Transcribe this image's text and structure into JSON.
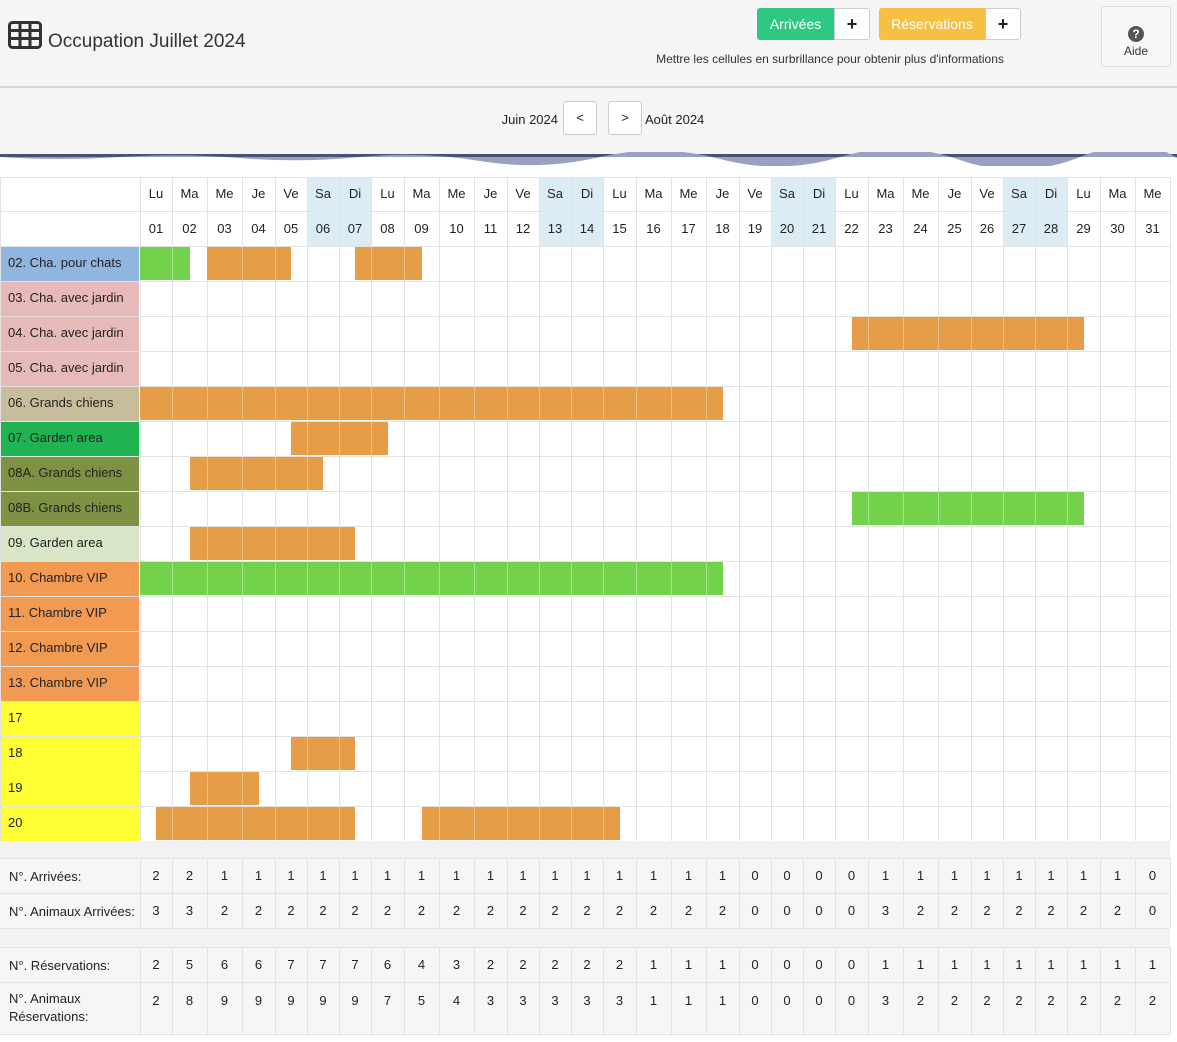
{
  "header": {
    "title": "Occupation Juillet 2024",
    "arrivals_button": "Arrivées",
    "reservations_button": "Réservations",
    "plus_label": "+",
    "hint": "Mettre les cellules en surbrillance pour obtenir plus d'informations",
    "help_label": "Aide",
    "help_icon": "question-circle-icon",
    "app_icon": "table-grid-icon"
  },
  "nav": {
    "prev_month": "Juin 2024",
    "next_month": "Août 2024",
    "prev_symbol": "<",
    "next_symbol": ">"
  },
  "colors": {
    "arrival_bar": "#74d14c",
    "reservation_bar": "#e69d47",
    "weekend_header": "#dcecf5",
    "arrivals_button": "#2ec883",
    "reservations_button": "#f6c143"
  },
  "days": [
    {
      "name": "Lu",
      "num": "01",
      "weekend": false
    },
    {
      "name": "Ma",
      "num": "02",
      "weekend": false
    },
    {
      "name": "Me",
      "num": "03",
      "weekend": false
    },
    {
      "name": "Je",
      "num": "04",
      "weekend": false
    },
    {
      "name": "Ve",
      "num": "05",
      "weekend": false
    },
    {
      "name": "Sa",
      "num": "06",
      "weekend": true
    },
    {
      "name": "Di",
      "num": "07",
      "weekend": true
    },
    {
      "name": "Lu",
      "num": "08",
      "weekend": false
    },
    {
      "name": "Ma",
      "num": "09",
      "weekend": false
    },
    {
      "name": "Me",
      "num": "10",
      "weekend": false
    },
    {
      "name": "Je",
      "num": "11",
      "weekend": false
    },
    {
      "name": "Ve",
      "num": "12",
      "weekend": false
    },
    {
      "name": "Sa",
      "num": "13",
      "weekend": true
    },
    {
      "name": "Di",
      "num": "14",
      "weekend": true
    },
    {
      "name": "Lu",
      "num": "15",
      "weekend": false
    },
    {
      "name": "Ma",
      "num": "16",
      "weekend": false
    },
    {
      "name": "Me",
      "num": "17",
      "weekend": false
    },
    {
      "name": "Je",
      "num": "18",
      "weekend": false
    },
    {
      "name": "Ve",
      "num": "19",
      "weekend": false
    },
    {
      "name": "Sa",
      "num": "20",
      "weekend": true
    },
    {
      "name": "Di",
      "num": "21",
      "weekend": true
    },
    {
      "name": "Lu",
      "num": "22",
      "weekend": false
    },
    {
      "name": "Ma",
      "num": "23",
      "weekend": false
    },
    {
      "name": "Me",
      "num": "24",
      "weekend": false
    },
    {
      "name": "Je",
      "num": "25",
      "weekend": false
    },
    {
      "name": "Ve",
      "num": "26",
      "weekend": false
    },
    {
      "name": "Sa",
      "num": "27",
      "weekend": true
    },
    {
      "name": "Di",
      "num": "28",
      "weekend": true
    },
    {
      "name": "Lu",
      "num": "29",
      "weekend": false
    },
    {
      "name": "Ma",
      "num": "30",
      "weekend": false
    },
    {
      "name": "Me",
      "num": "31",
      "weekend": false
    }
  ],
  "rooms": [
    {
      "label": "02. Cha. pour chats",
      "color": "#8fb5e0",
      "bookings": [
        {
          "start": 1,
          "end": 2.5,
          "kind": "arrival"
        },
        {
          "start": 3,
          "end": 5.5,
          "kind": "reservation"
        },
        {
          "start": 7.5,
          "end": 9.5,
          "kind": "reservation"
        }
      ]
    },
    {
      "label": "03. Cha. avec jardin",
      "color": "#e8b9b9",
      "bookings": []
    },
    {
      "label": "04. Cha. avec jardin",
      "color": "#e8b9b9",
      "bookings": [
        {
          "start": 22.5,
          "end": 29.5,
          "kind": "reservation"
        }
      ]
    },
    {
      "label": "05. Cha. avec jardin",
      "color": "#e8b9b9",
      "bookings": []
    },
    {
      "label": "06. Grands chiens",
      "color": "#c8bd9b",
      "bookings": [
        {
          "start": 1,
          "end": 18.5,
          "kind": "reservation"
        }
      ]
    },
    {
      "label": "07. Garden area",
      "color": "#1fb352",
      "bookings": [
        {
          "start": 5.5,
          "end": 8.5,
          "kind": "reservation"
        }
      ]
    },
    {
      "label": "08A. Grands chiens",
      "color": "#7d9243",
      "bookings": [
        {
          "start": 2.5,
          "end": 6.5,
          "kind": "reservation"
        }
      ]
    },
    {
      "label": "08B. Grands chiens",
      "color": "#7d9243",
      "bookings": [
        {
          "start": 22.5,
          "end": 29.5,
          "kind": "arrival"
        }
      ]
    },
    {
      "label": "09.  Garden area",
      "color": "#d8e5c7",
      "bookings": [
        {
          "start": 2.5,
          "end": 7.5,
          "kind": "reservation"
        }
      ]
    },
    {
      "label": "10.  Chambre VIP",
      "color": "#f39a52",
      "bookings": [
        {
          "start": 1,
          "end": 18.5,
          "kind": "arrival"
        }
      ]
    },
    {
      "label": "11.  Chambre VIP",
      "color": "#f39a52",
      "bookings": []
    },
    {
      "label": "12.  Chambre VIP",
      "color": "#f39a52",
      "bookings": []
    },
    {
      "label": "13.  Chambre VIP",
      "color": "#f39a52",
      "bookings": []
    },
    {
      "label": "17",
      "color": "#ffff33",
      "bookings": []
    },
    {
      "label": "18",
      "color": "#ffff33",
      "bookings": [
        {
          "start": 5.5,
          "end": 7.5,
          "kind": "reservation"
        }
      ]
    },
    {
      "label": "19",
      "color": "#ffff33",
      "bookings": [
        {
          "start": 2.5,
          "end": 4.5,
          "kind": "reservation"
        }
      ]
    },
    {
      "label": "20",
      "color": "#ffff33",
      "bookings": [
        {
          "start": 1.5,
          "end": 7.5,
          "kind": "reservation"
        },
        {
          "start": 9.5,
          "end": 15.5,
          "kind": "reservation"
        }
      ]
    }
  ],
  "stats": [
    {
      "label": "N°. Arrivées:",
      "values": [
        2,
        2,
        1,
        1,
        1,
        1,
        1,
        1,
        1,
        1,
        1,
        1,
        1,
        1,
        1,
        1,
        1,
        1,
        0,
        0,
        0,
        0,
        1,
        1,
        1,
        1,
        1,
        1,
        1,
        1,
        0
      ]
    },
    {
      "label": "N°. Animaux Arrivées:",
      "values": [
        3,
        3,
        2,
        2,
        2,
        2,
        2,
        2,
        2,
        2,
        2,
        2,
        2,
        2,
        2,
        2,
        2,
        2,
        0,
        0,
        0,
        0,
        3,
        2,
        2,
        2,
        2,
        2,
        2,
        2,
        0
      ]
    },
    {
      "label": "N°. Réservations:",
      "values": [
        2,
        5,
        6,
        6,
        7,
        7,
        7,
        6,
        4,
        3,
        2,
        2,
        2,
        2,
        2,
        1,
        1,
        1,
        0,
        0,
        0,
        0,
        1,
        1,
        1,
        1,
        1,
        1,
        1,
        1,
        1
      ]
    },
    {
      "label": "N°. Animaux Réservations:",
      "values": [
        2,
        8,
        9,
        9,
        9,
        9,
        9,
        7,
        5,
        4,
        3,
        3,
        3,
        3,
        3,
        1,
        1,
        1,
        0,
        0,
        0,
        0,
        3,
        2,
        2,
        2,
        2,
        2,
        2,
        2,
        2
      ]
    }
  ]
}
